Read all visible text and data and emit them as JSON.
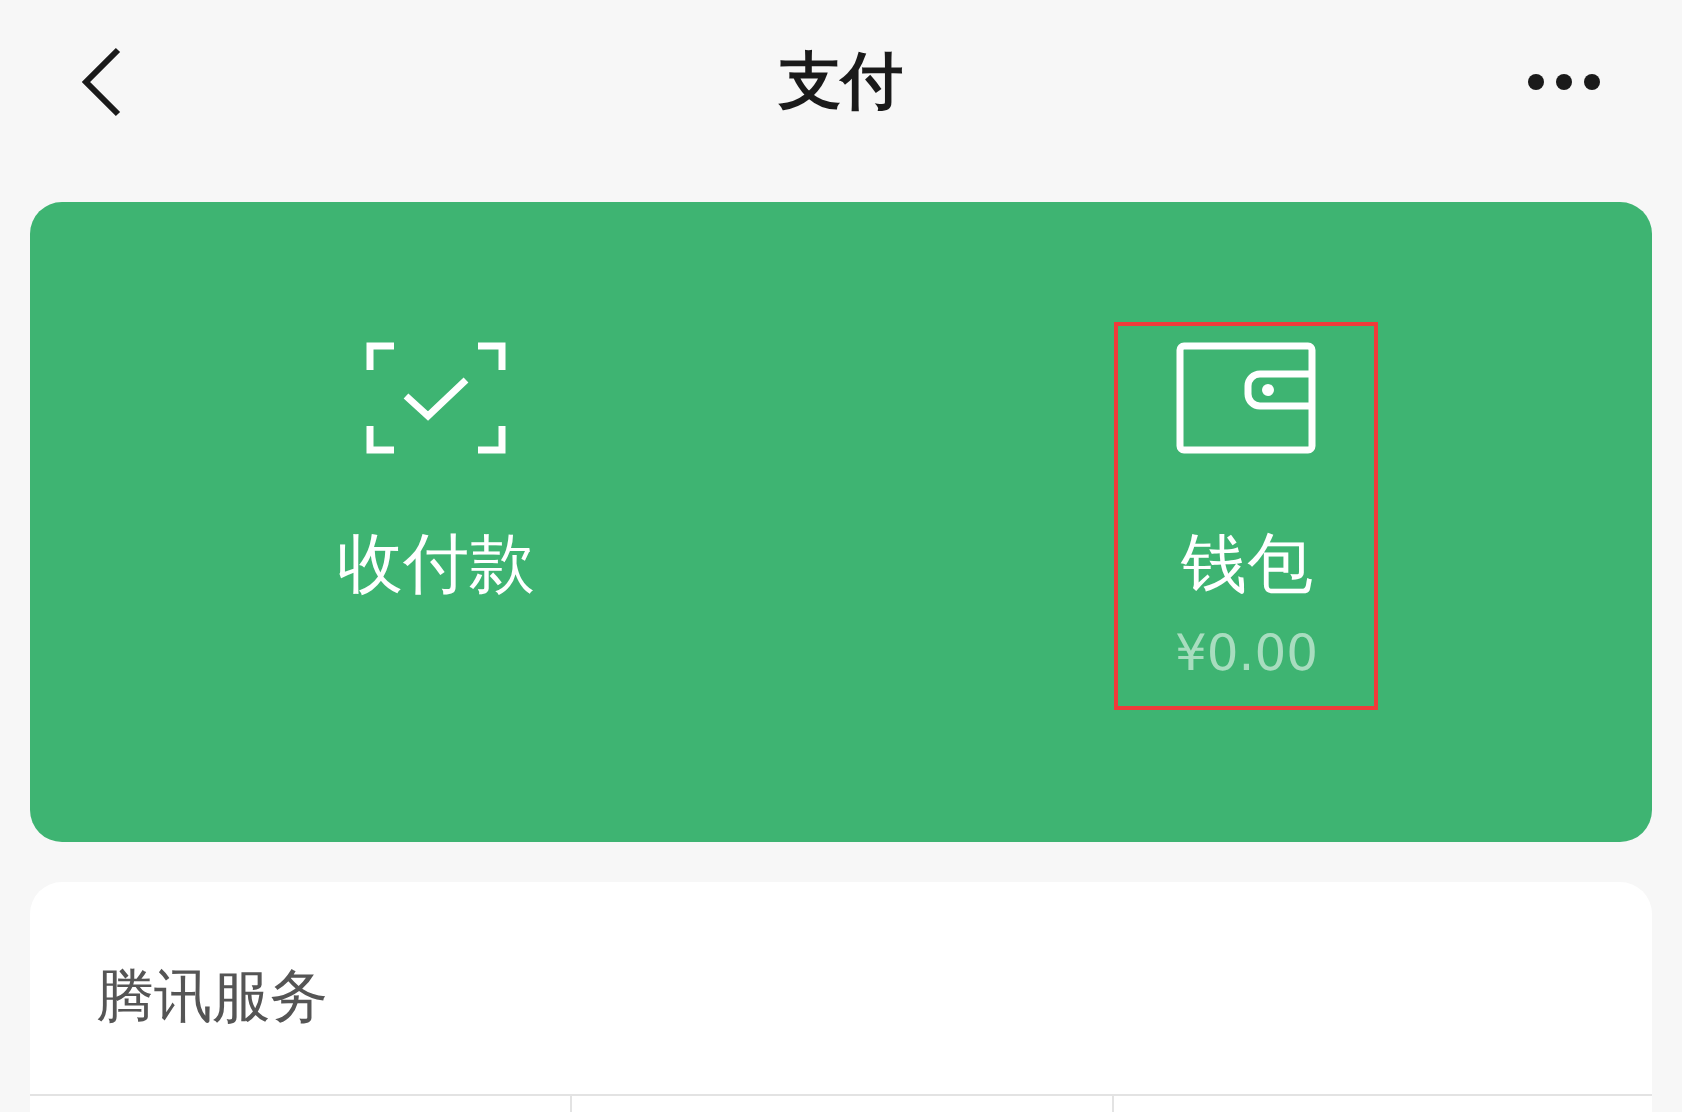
{
  "header": {
    "title": "支付"
  },
  "actions": [
    {
      "kind": "scan",
      "label": "收付款",
      "highlighted": false
    },
    {
      "kind": "wallet",
      "label": "钱包",
      "balance": "¥0.00",
      "highlighted": true
    }
  ],
  "services": {
    "title": "腾讯服务"
  }
}
